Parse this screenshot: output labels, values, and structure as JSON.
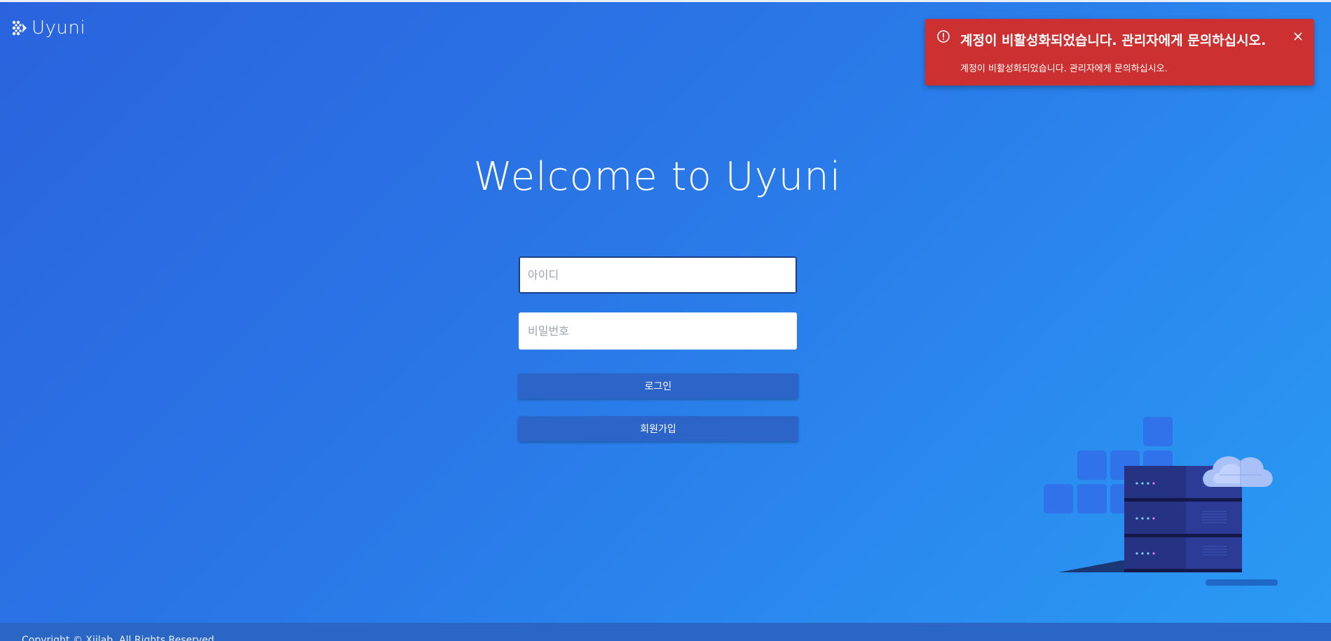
{
  "app": {
    "logo_text": "Uyuni"
  },
  "login": {
    "heading": "Welcome to Uyuni",
    "username_placeholder": "아이디",
    "username_value": "",
    "password_placeholder": "비밀번호",
    "password_value": "",
    "login_label": "로그인",
    "signup_label": "회원가입"
  },
  "toast": {
    "title": "계정이 비활성화되었습니다. 관리자에게 문의하십시오.",
    "message": "계정이 비활성화되었습니다. 관리자에게 문의하십시오.",
    "icon": "alert-circle-icon",
    "close_icon": "close-icon",
    "color": "#cc3030"
  },
  "footer": {
    "copyright": "Copyright © Xiilab. All Rights Reserved."
  },
  "theme": {
    "accent": "#2d64c7",
    "gradient_start": "#2a63dd",
    "gradient_end": "#2a9bf4"
  },
  "illustration": {
    "icon": "server-cloud-illustration"
  }
}
